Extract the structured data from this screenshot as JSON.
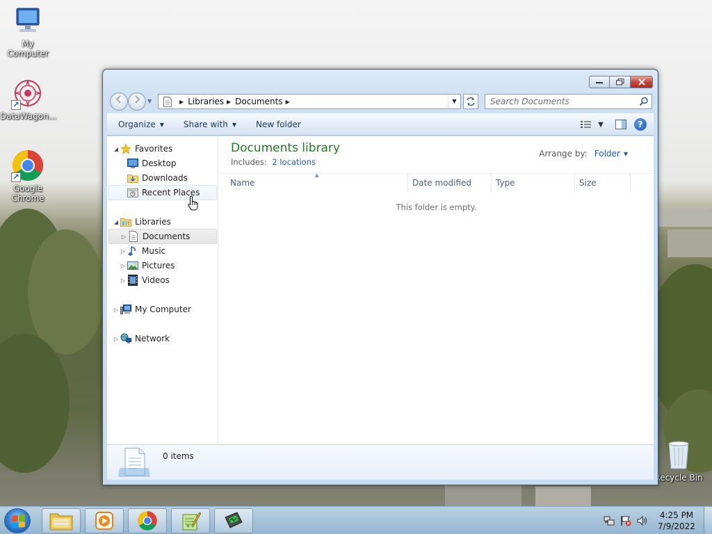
{
  "desktop": {
    "icons": [
      {
        "label": "My Computer",
        "icon": "computer-icon"
      },
      {
        "label": "DataWagon...",
        "icon": "datawagon-icon",
        "shortcut": true
      },
      {
        "label": "Google Chrome",
        "icon": "chrome-icon",
        "shortcut": true
      },
      {
        "label": "Recycle Bin",
        "icon": "recycle-bin-icon"
      }
    ]
  },
  "window": {
    "address": {
      "segments": [
        "Libraries",
        "Documents"
      ]
    },
    "search": {
      "placeholder": "Search Documents"
    },
    "toolbar": {
      "organize": "Organize",
      "share_with": "Share with",
      "new_folder": "New folder"
    },
    "nav": {
      "favorites": "Favorites",
      "favorites_items": [
        "Desktop",
        "Downloads",
        "Recent Places"
      ],
      "libraries": "Libraries",
      "libraries_items": [
        "Documents",
        "Music",
        "Pictures",
        "Videos"
      ],
      "my_computer": "My Computer",
      "network": "Network",
      "hovered": "Recent Places",
      "selected": "Documents"
    },
    "library": {
      "title": "Documents library",
      "includes_label": "Includes:",
      "includes_link": "2 locations",
      "arrange_label": "Arrange by:",
      "arrange_value": "Folder"
    },
    "columns": [
      "Name",
      "Date modified",
      "Type",
      "Size"
    ],
    "empty_message": "This folder is empty.",
    "status": {
      "item_count": "0 items"
    }
  },
  "taskbar": {
    "pinned": [
      "explorer-icon",
      "media-player-icon",
      "chrome-icon",
      "notepad-plus-icon",
      "cheat-engine-icon"
    ],
    "clock": {
      "time": "4:25 PM",
      "date": "7/9/2022"
    }
  },
  "colors": {
    "library_title": "#1e7d22",
    "link": "#1e5cb4",
    "close_button": "#c7463a"
  }
}
